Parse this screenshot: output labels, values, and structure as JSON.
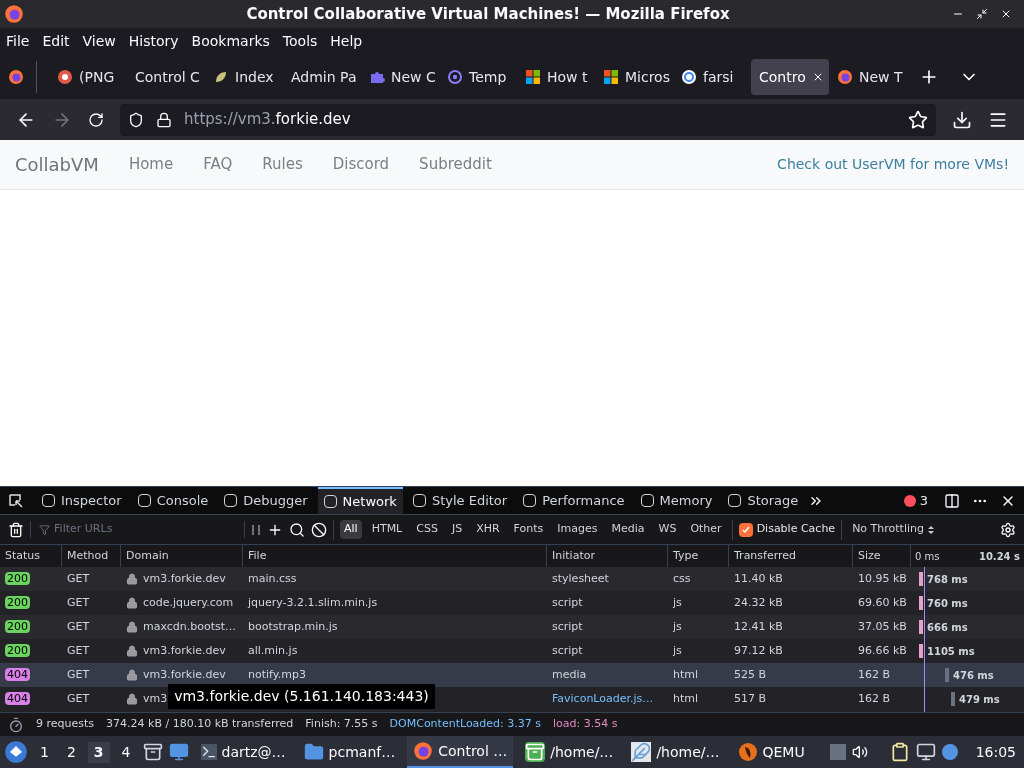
{
  "window": {
    "title": "Control Collaborative Virtual Machines! — Mozilla Firefox"
  },
  "menu": [
    "File",
    "Edit",
    "View",
    "History",
    "Bookmarks",
    "Tools",
    "Help"
  ],
  "tabs": [
    {
      "label": "(PNG",
      "selected": false
    },
    {
      "label": "Control C",
      "selected": false
    },
    {
      "label": "Index",
      "selected": false
    },
    {
      "label": "Admin Pa",
      "selected": false
    },
    {
      "label": "New C",
      "selected": false
    },
    {
      "label": "Temp",
      "selected": false
    },
    {
      "label": "How t",
      "selected": false
    },
    {
      "label": "Micros",
      "selected": false
    },
    {
      "label": "farsi",
      "selected": false
    },
    {
      "label": "Contro",
      "selected": true
    },
    {
      "label": "New T",
      "selected": false
    }
  ],
  "address": {
    "prefix": "https://vm3.",
    "host": "forkie.dev"
  },
  "site": {
    "brand": "CollabVM",
    "links": [
      "Home",
      "FAQ",
      "Rules",
      "Discord",
      "Subreddit"
    ],
    "promo": "Check out UserVM for more VMs!"
  },
  "devtools": {
    "panels": [
      {
        "label": "Inspector",
        "selected": false
      },
      {
        "label": "Console",
        "selected": false
      },
      {
        "label": "Debugger",
        "selected": false
      },
      {
        "label": "Network",
        "selected": true
      },
      {
        "label": "Style Editor",
        "selected": false
      },
      {
        "label": "Performance",
        "selected": false
      },
      {
        "label": "Memory",
        "selected": false
      },
      {
        "label": "Storage",
        "selected": false
      }
    ],
    "error_count": "3",
    "filter": {
      "placeholder": "Filter URLs"
    },
    "types": [
      {
        "label": "All",
        "selected": true
      },
      {
        "label": "HTML",
        "selected": false
      },
      {
        "label": "CSS",
        "selected": false
      },
      {
        "label": "JS",
        "selected": false
      },
      {
        "label": "XHR",
        "selected": false
      },
      {
        "label": "Fonts",
        "selected": false
      },
      {
        "label": "Images",
        "selected": false
      },
      {
        "label": "Media",
        "selected": false
      },
      {
        "label": "WS",
        "selected": false
      },
      {
        "label": "Other",
        "selected": false
      }
    ],
    "disable_cache": {
      "label": "Disable Cache",
      "checked": true
    },
    "throttling": "No Throttling",
    "columns": [
      "Status",
      "Method",
      "Domain",
      "File",
      "Initiator",
      "Type",
      "Transferred",
      "Size"
    ],
    "waterfall_ticks": [
      "0 ms",
      "10.24 s"
    ],
    "rows": [
      {
        "status": "200",
        "color": "#6bd35f",
        "method": "GET",
        "domain": "vm3.forkie.dev",
        "file": "main.css",
        "initiator": "stylesheet",
        "link": false,
        "type": "css",
        "transferred": "11.40 kB",
        "size": "10.95 kB",
        "time": "768 ms",
        "selected": false
      },
      {
        "status": "200",
        "color": "#6bd35f",
        "method": "GET",
        "domain": "code.jquery.com",
        "file": "jquery-3.2.1.slim.min.js",
        "initiator": "script",
        "link": false,
        "type": "js",
        "transferred": "24.32 kB",
        "size": "69.60 kB",
        "time": "760 ms",
        "selected": false
      },
      {
        "status": "200",
        "color": "#6bd35f",
        "method": "GET",
        "domain": "maxcdn.bootst…",
        "file": "bootstrap.min.js",
        "initiator": "script",
        "link": false,
        "type": "js",
        "transferred": "12.41 kB",
        "size": "37.05 kB",
        "time": "666 ms",
        "selected": false
      },
      {
        "status": "200",
        "color": "#6bd35f",
        "method": "GET",
        "domain": "vm3.forkie.dev",
        "file": "all.min.js",
        "initiator": "script",
        "link": false,
        "type": "js",
        "transferred": "97.12 kB",
        "size": "96.66 kB",
        "time": "1105 ms",
        "selected": false
      },
      {
        "status": "404",
        "color": "#d97fe8",
        "method": "GET",
        "domain": "vm3.forkie.dev",
        "file": "notify.mp3",
        "initiator": "media",
        "link": false,
        "type": "html",
        "transferred": "525 B",
        "size": "162 B",
        "time": "476 ms",
        "selected": true
      },
      {
        "status": "404",
        "color": "#d97fe8",
        "method": "GET",
        "domain": "vm3",
        "initiator": "FaviconLoader.js…",
        "link": true,
        "type": "html",
        "transferred": "517 B",
        "size": "162 B",
        "time": "479 ms",
        "selected": false
      }
    ],
    "tooltip": "vm3.forkie.dev (5.161.140.183:443)",
    "summary": {
      "requests": "9 requests",
      "transferred": "374.24 kB / 180.10 kB transferred",
      "finish": "Finish: 7.55 s",
      "dom": "DOMContentLoaded: 3.37 s",
      "load": "load: 3.54 s"
    }
  },
  "taskbar": {
    "workspaces": [
      {
        "label": "1",
        "selected": false
      },
      {
        "label": "2",
        "selected": false
      },
      {
        "label": "3",
        "selected": true
      },
      {
        "label": "4",
        "selected": false
      }
    ],
    "tasks": [
      {
        "label": "dartz@…",
        "selected": false
      },
      {
        "label": "pcmanf…",
        "selected": false
      },
      {
        "label": "Control …",
        "selected": true
      },
      {
        "label": "/home/…",
        "selected": false
      },
      {
        "label": "/home/…",
        "selected": false
      },
      {
        "label": "QEMU",
        "selected": false
      }
    ],
    "clock": "16:05"
  }
}
